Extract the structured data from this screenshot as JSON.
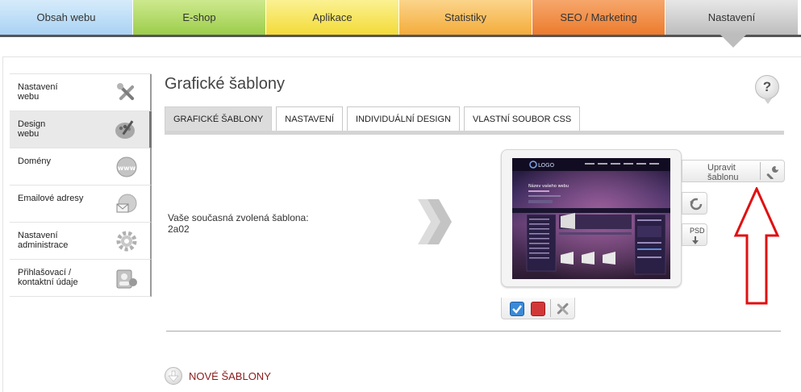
{
  "topnav": {
    "tabs": [
      {
        "label": "Obsah webu"
      },
      {
        "label": "E-shop"
      },
      {
        "label": "Aplikace"
      },
      {
        "label": "Statistiky"
      },
      {
        "label": "SEO / Marketing"
      },
      {
        "label": "Nastavení"
      }
    ],
    "active_index": 5
  },
  "sidebar": {
    "items": [
      {
        "label_line1": "Nastavení",
        "label_line2": "webu",
        "icon": "tools-icon"
      },
      {
        "label_line1": "Design",
        "label_line2": "webu",
        "icon": "palette-icon",
        "active": true
      },
      {
        "label_line1": "Domény",
        "label_line2": "",
        "icon": "www-globe-icon"
      },
      {
        "label_line1": "Emailové adresy",
        "label_line2": "",
        "icon": "email-globe-icon"
      },
      {
        "label_line1": "Nastavení",
        "label_line2": "administrace",
        "icon": "gear-icon"
      },
      {
        "label_line1": "Přihlašovací /",
        "label_line2": "kontaktní údaje",
        "icon": "contacts-icon"
      }
    ]
  },
  "main": {
    "title": "Grafické šablony",
    "help_label": "?",
    "tabs": [
      {
        "label": "GRAFICKÉ ŠABLONY",
        "active": true
      },
      {
        "label": "NASTAVENÍ"
      },
      {
        "label": "INDIVIDUÁLNÍ DESIGN"
      },
      {
        "label": "VLASTNÍ SOUBOR CSS"
      }
    ],
    "current_template_label": "Vaše současná zvolená šablona:",
    "current_template_value": "2a02",
    "preview": {
      "logo_text": "LOGO",
      "headline": "Název vašeho webu"
    },
    "edit_button_line1": "Upravit",
    "edit_button_line2": "šablonu",
    "psd_label": "PSD",
    "new_templates_label": "NOVÉ ŠABLONY"
  },
  "colors": {
    "new_templates_text": "#8a1a1a",
    "annotation_arrow": "#e01010"
  }
}
